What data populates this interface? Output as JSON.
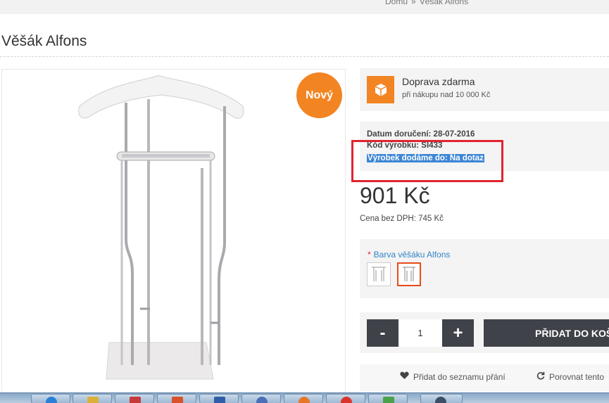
{
  "breadcrumb": {
    "home": "Domů",
    "separator": "»",
    "current": "Věšák Alfons"
  },
  "product": {
    "title": "Věšák Alfons",
    "badge": "Nový",
    "image_icon": "coat-valet-stand-image"
  },
  "shipping": {
    "icon": "box-icon",
    "title": "Doprava zdarma",
    "subtitle": "při nákupu nad 10 000 Kč"
  },
  "info": {
    "delivery_date": "Datum doručení: 28-07-2016",
    "product_code": "Kód výrobku: SI433",
    "availability": "Výrobek dodáme do: Na dotaz"
  },
  "price": {
    "value": "901 Kč",
    "without_vat": "Cena bez DPH: 745 Kč"
  },
  "variant": {
    "required_mark": "*",
    "label": "Barva věšáku Alfons",
    "swatches": [
      {
        "name": "white",
        "selected": false
      },
      {
        "name": "chrome",
        "selected": true
      }
    ]
  },
  "cart": {
    "minus": "-",
    "quantity": "1",
    "plus": "+",
    "add_label": "PŘIDAT DO KOŠÍKU"
  },
  "actions": {
    "wishlist": "Přidat do seznamu přání",
    "compare": "Porovnat tento"
  },
  "colors": {
    "accent": "#f28422",
    "highlight_box": "#e0232f",
    "selection": "#3d86d6",
    "button": "#404249",
    "link": "#2f84c6"
  },
  "taskbar": {
    "items": [
      "ie-icon",
      "explorer-icon",
      "acrobat-icon",
      "word-icon",
      "network-icon",
      "firefox-icon",
      "chrome-icon",
      "app-icon",
      "app-icon-2"
    ]
  }
}
